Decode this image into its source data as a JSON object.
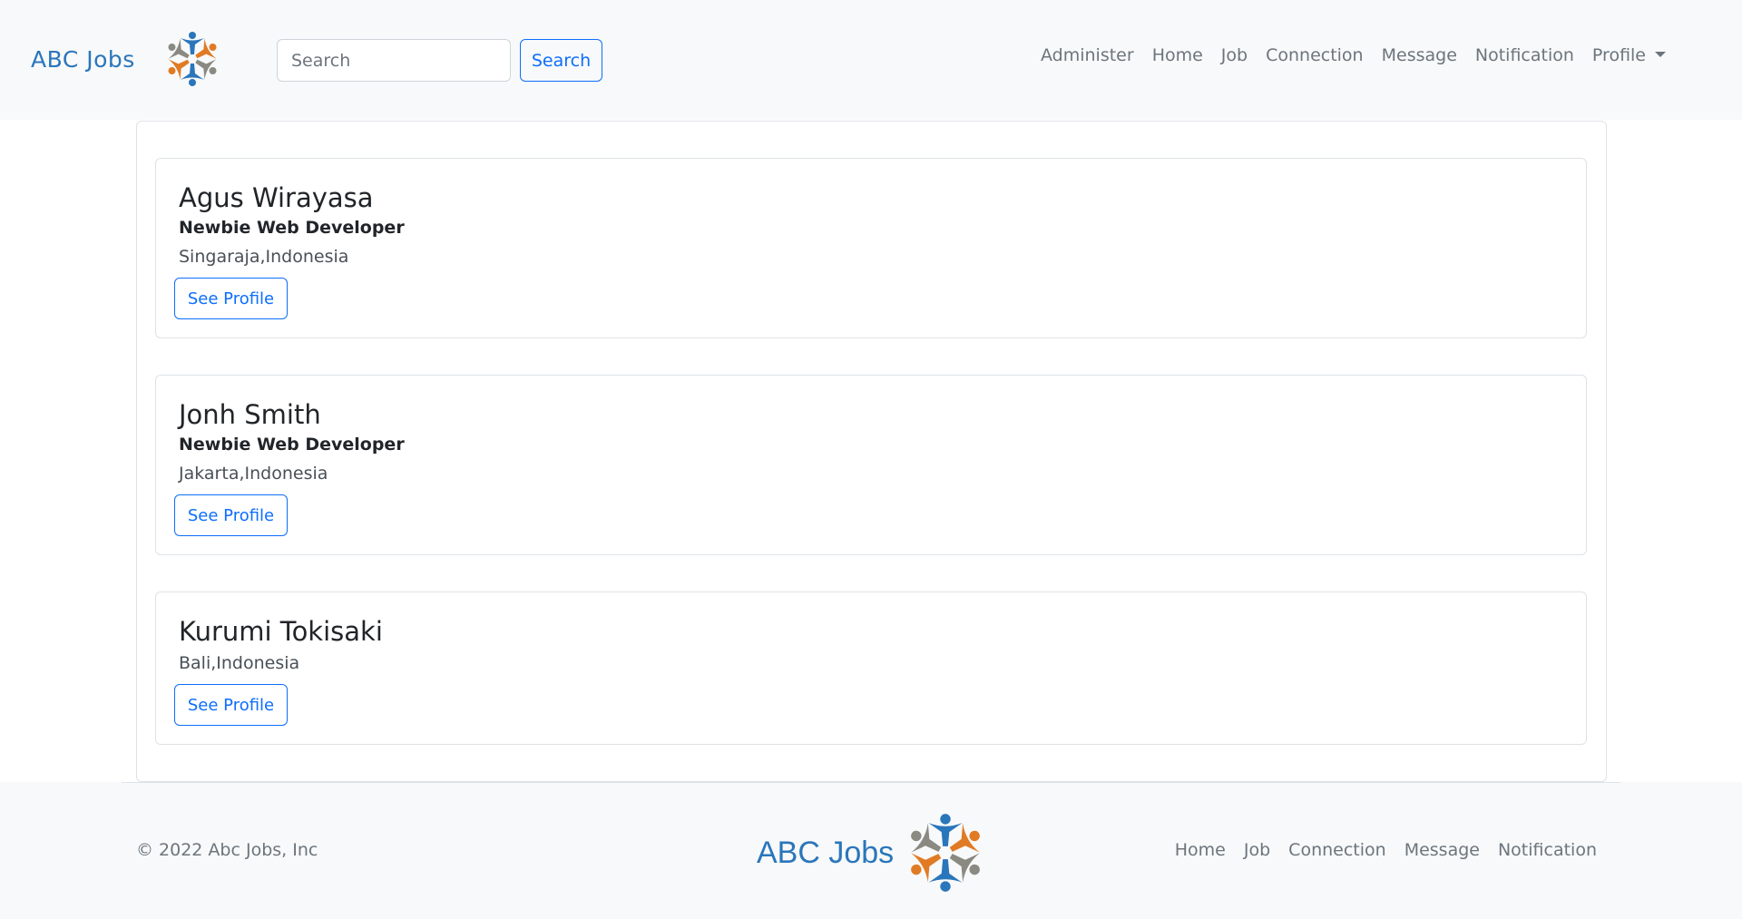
{
  "colors": {
    "accent": "#0d6efd",
    "brand_blue": "#2a76bb",
    "brand_orange": "#e07b24",
    "brand_gray": "#8a8a82",
    "navbar_bg": "#f8f9fa"
  },
  "header": {
    "brand": "ABC Jobs",
    "logo_icon": "people-circle-logo-icon",
    "search": {
      "placeholder": "Search",
      "value": "",
      "button_label": "Search"
    },
    "nav": [
      "Administer",
      "Home",
      "Job",
      "Connection",
      "Message",
      "Notification"
    ],
    "profile_label": "Profile"
  },
  "results": [
    {
      "name": "Agus Wirayasa",
      "title": "Newbie Web Developer",
      "location": "Singaraja,Indonesia",
      "button": "See Profile"
    },
    {
      "name": "Jonh Smith",
      "title": "Newbie Web Developer",
      "location": "Jakarta,Indonesia",
      "button": "See Profile"
    },
    {
      "name": "Kurumi Tokisaki",
      "title": "",
      "location": "Bali,Indonesia",
      "button": "See Profile"
    }
  ],
  "footer": {
    "copyright": "© 2022 Abc Jobs, Inc",
    "brand": "ABC Jobs",
    "links": [
      "Home",
      "Job",
      "Connection",
      "Message",
      "Notification"
    ]
  }
}
